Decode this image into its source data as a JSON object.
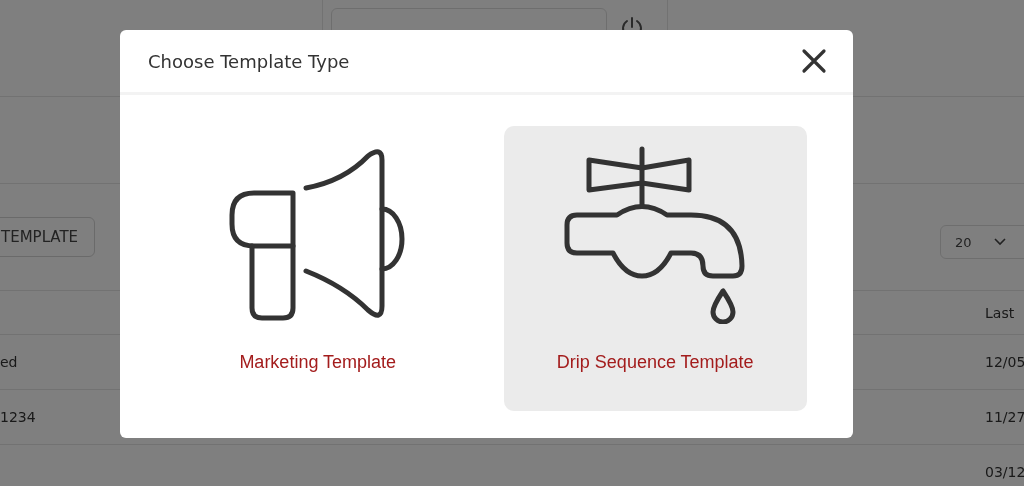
{
  "page": {
    "toolbar_button": "TEMPLATE",
    "page_size": "20",
    "table": {
      "header": "Last",
      "rows": [
        {
          "column_1": "ed",
          "column_2": "12/05"
        },
        {
          "column_1": "1234",
          "column_2": "11/27"
        },
        {
          "column_2": "03/12"
        }
      ]
    }
  },
  "modal": {
    "title": "Choose Template Type",
    "options": [
      {
        "label": "Marketing Template",
        "kind": "megaphone",
        "selected": false
      },
      {
        "label": "Drip Sequence Template",
        "kind": "faucet",
        "selected": true
      }
    ]
  }
}
